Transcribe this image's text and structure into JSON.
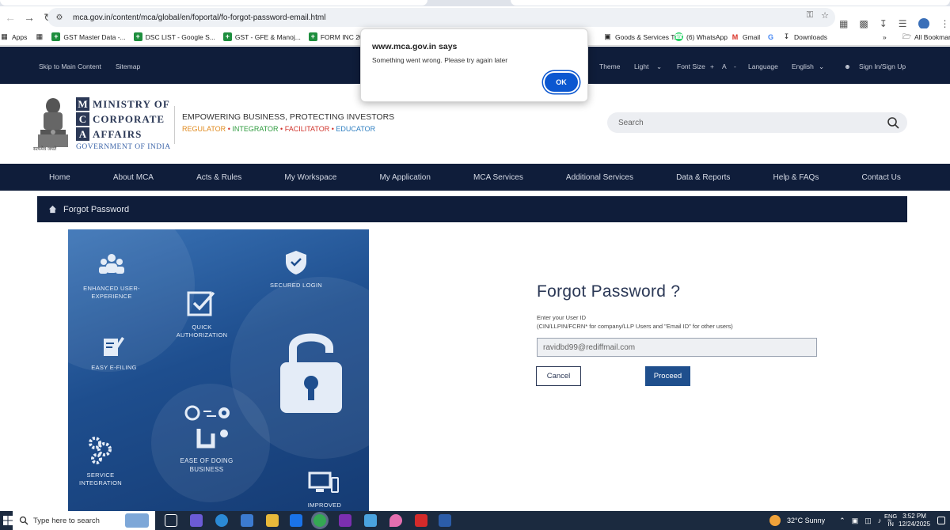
{
  "browser": {
    "url": "mca.gov.in/content/mca/global/en/foportal/fo-forgot-password-email.html",
    "bookmarks": [
      "Apps",
      "GST Master Data -...",
      "DSC LIST - Google S...",
      "GST - GFE & Manoj...",
      "FORM INC 20A/22/...",
      "Goods & Services T...",
      "(6) WhatsApp",
      "Gmail",
      "Downloads",
      "All Bookmarks"
    ]
  },
  "topbar": {
    "skip": "Skip to Main Content",
    "sitemap": "Sitemap",
    "theme_label": "Theme",
    "theme_value": "Light",
    "font_label": "Font Size",
    "font_plus": "+",
    "font_a": "A",
    "font_minus": "-",
    "language_label": "Language",
    "language_value": "English",
    "signin": "Sign In/Sign Up"
  },
  "header": {
    "logo_letters": [
      "M",
      "C",
      "A"
    ],
    "logo_words": [
      "MINISTRY OF",
      "CORPORATE",
      "AFFAIRS"
    ],
    "government": "GOVERNMENT OF INDIA",
    "emblem_caption": "सत्यमेव जयते",
    "tagline": "EMPOWERING BUSINESS, PROTECTING INVESTORS",
    "roles": [
      {
        "text": "REGULATOR",
        "color": "#e08a1e"
      },
      {
        "text": "INTEGRATOR",
        "color": "#2e9b3e"
      },
      {
        "text": "FACILITATOR",
        "color": "#d0332b"
      },
      {
        "text": "EDUCATOR",
        "color": "#2f7fc1"
      }
    ],
    "search_placeholder": "Search"
  },
  "nav": [
    "Home",
    "About MCA",
    "Acts & Rules",
    "My Workspace",
    "My Application",
    "MCA Services",
    "Additional Services",
    "Data & Reports",
    "Help & FAQs",
    "Contact Us"
  ],
  "breadcrumb": "Forgot Password",
  "promo": {
    "labels": [
      "ENHANCED USER-EXPERIENCE",
      "SECURED LOGIN",
      "QUICK AUTHORIZATION",
      "EASY E-FILING",
      "EASE OF DOING BUSINESS",
      "SERVICE INTEGRATION",
      "IMPROVED"
    ]
  },
  "form": {
    "title": "Forgot Password ?",
    "help_line1": "Enter your User ID",
    "help_line2": "(CIN/LLPIN/FCRN* for company/LLP Users and \"Email ID\" for other users)",
    "input_value": "ravidbd99@rediffmail.com",
    "cancel": "Cancel",
    "proceed": "Proceed"
  },
  "dialog": {
    "title": "www.mca.gov.in says",
    "message": "Something went wrong. Please try again later",
    "ok": "OK"
  },
  "taskbar": {
    "search": "Type here to search",
    "weather": "32°C  Sunny",
    "lang1": "ENG",
    "lang2": "IN",
    "time": "3:52 PM",
    "date": "12/24/2025"
  }
}
